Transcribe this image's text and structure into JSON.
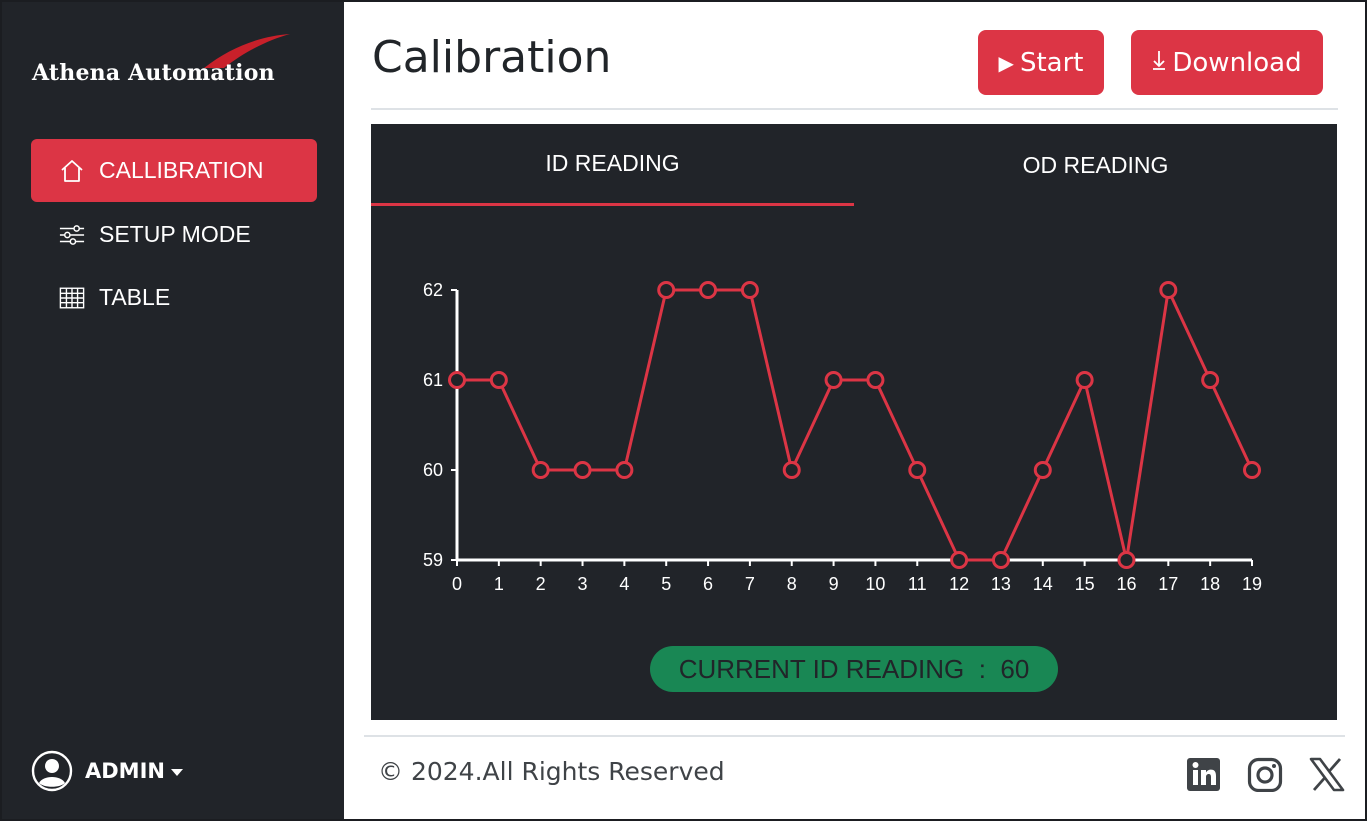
{
  "brand": {
    "name": "Athena Automation"
  },
  "sidebar": {
    "items": [
      {
        "label": "CALLIBRATION",
        "icon": "home-icon",
        "active": true
      },
      {
        "label": "SETUP MODE",
        "icon": "sliders-icon",
        "active": false
      },
      {
        "label": "TABLE",
        "icon": "table-icon",
        "active": false
      }
    ],
    "user": {
      "label": "ADMIN",
      "icon": "user-circle-icon"
    }
  },
  "header": {
    "title": "Calibration",
    "start_label": "Start",
    "download_label": "Download"
  },
  "tabs": [
    {
      "label": "ID READING",
      "active": true
    },
    {
      "label": "OD READING",
      "active": false
    }
  ],
  "current_reading": {
    "label": "CURRENT ID READING  :  60"
  },
  "footer": {
    "copyright": "© 2024.All Rights Reserved",
    "social": [
      "linkedin-icon",
      "instagram-icon",
      "x-icon"
    ]
  },
  "colors": {
    "accent": "#dc3545",
    "sidebar_bg": "#212429",
    "panel_bg": "#212429",
    "pill_bg": "#198754",
    "line": "#dc3545"
  },
  "chart_data": {
    "type": "line",
    "x": [
      0,
      1,
      2,
      3,
      4,
      5,
      6,
      7,
      8,
      9,
      10,
      11,
      12,
      13,
      14,
      15,
      16,
      17,
      18,
      19
    ],
    "series": [
      {
        "values": [
          61,
          61,
          60,
          60,
          60,
          62,
          62,
          62,
          60,
          61,
          61,
          60,
          59,
          59,
          60,
          61,
          59,
          62,
          61,
          60
        ]
      }
    ],
    "ylim": [
      59,
      62
    ],
    "yticks": [
      59,
      60,
      61,
      62
    ],
    "xticks": [
      0,
      1,
      2,
      3,
      4,
      5,
      6,
      7,
      8,
      9,
      10,
      11,
      12,
      13,
      14,
      15,
      16,
      17,
      18,
      19
    ],
    "grid": false,
    "marker": "open-circle"
  }
}
